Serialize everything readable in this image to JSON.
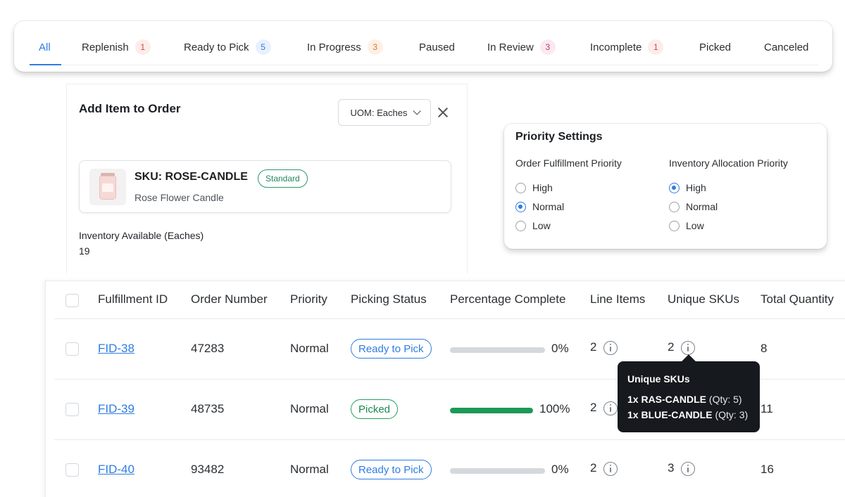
{
  "tabs": [
    {
      "label": "All",
      "count": null,
      "active": true
    },
    {
      "label": "Replenish",
      "count": "1",
      "color": "red"
    },
    {
      "label": "Ready to Pick",
      "count": "5",
      "color": "blue"
    },
    {
      "label": "In Progress",
      "count": "3",
      "color": "orange"
    },
    {
      "label": "Paused",
      "count": null
    },
    {
      "label": "In Review",
      "count": "3",
      "color": "pink"
    },
    {
      "label": "Incomplete",
      "count": "1",
      "color": "red"
    },
    {
      "label": "Picked",
      "count": null
    },
    {
      "label": "Canceled",
      "count": null
    }
  ],
  "add_item": {
    "title": "Add Item to Order",
    "uom_label": "UOM: Eaches",
    "sku": "SKU: ROSE-CANDLE",
    "sku_badge": "Standard",
    "sku_description": "Rose Flower Candle",
    "inventory_label": "Inventory Available (Eaches)",
    "inventory_value": "19"
  },
  "priority": {
    "title": "Priority Settings",
    "fulfillment": {
      "label": "Order Fulfillment Priority",
      "options": [
        "High",
        "Normal",
        "Low"
      ],
      "selected": "Normal"
    },
    "allocation": {
      "label": "Inventory Allocation Priority",
      "options": [
        "High",
        "Normal",
        "Low"
      ],
      "selected": "High"
    }
  },
  "table": {
    "headers": [
      "Fulfillment ID",
      "Order Number",
      "Priority",
      "Picking Status",
      "Percentage Complete",
      "Line Items",
      "Unique SKUs",
      "Total Quantity"
    ],
    "rows": [
      {
        "fid": "FID-38",
        "order": "47283",
        "priority": "Normal",
        "status": "Ready to Pick",
        "status_type": "ready",
        "percent_label": "0%",
        "percent": 0,
        "line_items": "2",
        "unique_skus": "2",
        "total_qty": "8"
      },
      {
        "fid": "FID-39",
        "order": "48735",
        "priority": "Normal",
        "status": "Picked",
        "status_type": "picked",
        "percent_label": "100%",
        "percent": 100,
        "line_items": "2",
        "unique_skus": "",
        "total_qty": "11"
      },
      {
        "fid": "FID-40",
        "order": "93482",
        "priority": "Normal",
        "status": "Ready to Pick",
        "status_type": "ready",
        "percent_label": "0%",
        "percent": 0,
        "line_items": "2",
        "unique_skus": "3",
        "total_qty": "16"
      }
    ]
  },
  "tooltip": {
    "title": "Unique SKUs",
    "lines": [
      {
        "item": "1x RAS-CANDLE",
        "qty": "(Qty: 5)"
      },
      {
        "item": "1x BLUE-CANDLE",
        "qty": "(Qty: 3)"
      }
    ]
  },
  "colors": {
    "accent": "#2f7de1",
    "success": "#1c9a55"
  }
}
